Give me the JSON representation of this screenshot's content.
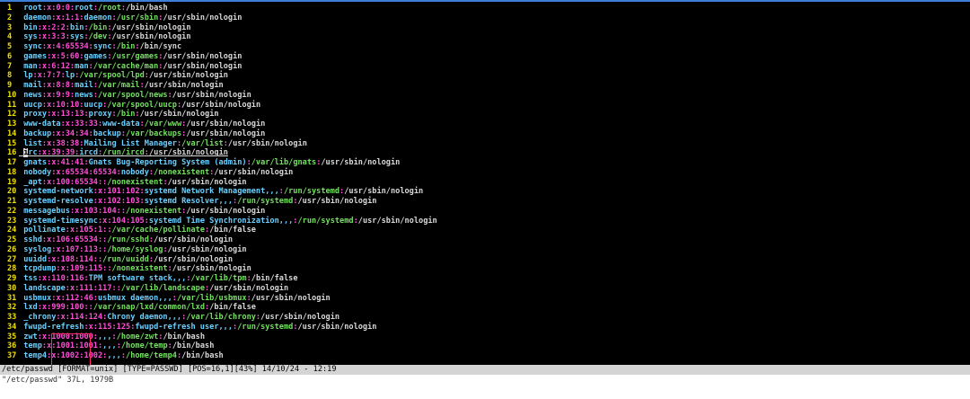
{
  "editor": {
    "lines": [
      {
        "n": "1",
        "user": "root",
        "x": ":x:0:0:",
        "gecos": "root",
        "home": "/root",
        "shell": "/bin/bash"
      },
      {
        "n": "2",
        "user": "daemon",
        "x": ":x:1:1:",
        "gecos": "daemon",
        "home": "/usr/sbin",
        "shell": "/usr/sbin/nologin"
      },
      {
        "n": "3",
        "user": "bin",
        "x": ":x:2:2:",
        "gecos": "bin",
        "home": "/bin",
        "shell": "/usr/sbin/nologin"
      },
      {
        "n": "4",
        "user": "sys",
        "x": ":x:3:3:",
        "gecos": "sys",
        "home": "/dev",
        "shell": "/usr/sbin/nologin"
      },
      {
        "n": "5",
        "user": "sync",
        "x": ":x:4:65534:",
        "gecos": "sync",
        "home": "/bin",
        "shell": "/bin/sync"
      },
      {
        "n": "6",
        "user": "games",
        "x": ":x:5:60:",
        "gecos": "games",
        "home": "/usr/games",
        "shell": "/usr/sbin/nologin"
      },
      {
        "n": "7",
        "user": "man",
        "x": ":x:6:12:",
        "gecos": "man",
        "home": "/var/cache/man",
        "shell": "/usr/sbin/nologin"
      },
      {
        "n": "8",
        "user": "lp",
        "x": ":x:7:7:",
        "gecos": "lp",
        "home": "/var/spool/lpd",
        "shell": "/usr/sbin/nologin"
      },
      {
        "n": "9",
        "user": "mail",
        "x": ":x:8:8:",
        "gecos": "mail",
        "home": "/var/mail",
        "shell": "/usr/sbin/nologin"
      },
      {
        "n": "10",
        "user": "news",
        "x": ":x:9:9:",
        "gecos": "news",
        "home": "/var/spool/news",
        "shell": "/usr/sbin/nologin"
      },
      {
        "n": "11",
        "user": "uucp",
        "x": ":x:10:10:",
        "gecos": "uucp",
        "home": "/var/spool/uucp",
        "shell": "/usr/sbin/nologin"
      },
      {
        "n": "12",
        "user": "proxy",
        "x": ":x:13:13:",
        "gecos": "proxy",
        "home": "/bin",
        "shell": "/usr/sbin/nologin"
      },
      {
        "n": "13",
        "user": "www-data",
        "x": ":x:33:33:",
        "gecos": "www-data",
        "home": "/var/www",
        "shell": "/usr/sbin/nologin"
      },
      {
        "n": "14",
        "user": "backup",
        "x": ":x:34:34:",
        "gecos": "backup",
        "home": "/var/backups",
        "shell": "/usr/sbin/nologin"
      },
      {
        "n": "15",
        "user": "list",
        "x": ":x:38:38:",
        "gecos": "Mailing List Manager",
        "home": "/var/list",
        "shell": "/usr/sbin/nologin"
      },
      {
        "n": "16",
        "user": "irc",
        "x": ":x:39:39:",
        "gecos": "ircd",
        "home": "/run/ircd",
        "shell": "/usr/sbin/nologin"
      },
      {
        "n": "17",
        "user": "gnats",
        "x": ":x:41:41:",
        "gecos": "Gnats Bug-Reporting System (admin)",
        "home": "/var/lib/gnats",
        "shell": "/usr/sbin/nologin"
      },
      {
        "n": "18",
        "user": "nobody",
        "x": ":x:65534:65534:",
        "gecos": "nobody",
        "home": "/nonexistent",
        "shell": "/usr/sbin/nologin"
      },
      {
        "n": "19",
        "user": "_apt",
        "x": ":x:100:65534:",
        "gecos": "",
        "home": "/nonexistent",
        "shell": "/usr/sbin/nologin"
      },
      {
        "n": "20",
        "user": "systemd-network",
        "x": ":x:101:102:",
        "gecos": "systemd Network Management,,,",
        "home": "/run/systemd",
        "shell": "/usr/sbin/nologin"
      },
      {
        "n": "21",
        "user": "systemd-resolve",
        "x": ":x:102:103:",
        "gecos": "systemd Resolver,,,",
        "home": "/run/systemd",
        "shell": "/usr/sbin/nologin"
      },
      {
        "n": "22",
        "user": "messagebus",
        "x": ":x:103:104:",
        "gecos": "",
        "home": "/nonexistent",
        "shell": "/usr/sbin/nologin"
      },
      {
        "n": "23",
        "user": "systemd-timesync",
        "x": ":x:104:105:",
        "gecos": "systemd Time Synchronization,,,",
        "home": "/run/systemd",
        "shell": "/usr/sbin/nologin"
      },
      {
        "n": "24",
        "user": "pollinate",
        "x": ":x:105:1:",
        "gecos": "",
        "home": "/var/cache/pollinate",
        "shell": "/bin/false"
      },
      {
        "n": "25",
        "user": "sshd",
        "x": ":x:106:65534:",
        "gecos": "",
        "home": "/run/sshd",
        "shell": "/usr/sbin/nologin"
      },
      {
        "n": "26",
        "user": "syslog",
        "x": ":x:107:113:",
        "gecos": "",
        "home": "/home/syslog",
        "shell": "/usr/sbin/nologin"
      },
      {
        "n": "27",
        "user": "uuidd",
        "x": ":x:108:114:",
        "gecos": "",
        "home": "/run/uuidd",
        "shell": "/usr/sbin/nologin"
      },
      {
        "n": "28",
        "user": "tcpdump",
        "x": ":x:109:115:",
        "gecos": "",
        "home": "/nonexistent",
        "shell": "/usr/sbin/nologin"
      },
      {
        "n": "29",
        "user": "tss",
        "x": ":x:110:116:",
        "gecos": "TPM software stack,,,",
        "home": "/var/lib/tpm",
        "shell": "/bin/false"
      },
      {
        "n": "30",
        "user": "landscape",
        "x": ":x:111:117:",
        "gecos": "",
        "home": "/var/lib/landscape",
        "shell": "/usr/sbin/nologin"
      },
      {
        "n": "31",
        "user": "usbmux",
        "x": ":x:112:46:",
        "gecos": "usbmux daemon,,,",
        "home": "/var/lib/usbmux",
        "shell": "/usr/sbin/nologin"
      },
      {
        "n": "32",
        "user": "lxd",
        "x": ":x:999:100:",
        "gecos": "",
        "home": "/var/snap/lxd/common/lxd",
        "shell": "/bin/false"
      },
      {
        "n": "33",
        "user": "_chrony",
        "x": ":x:114:124:",
        "gecos": "Chrony daemon,,,",
        "home": "/var/lib/chrony",
        "shell": "/usr/sbin/nologin"
      },
      {
        "n": "34",
        "user": "fwupd-refresh",
        "x": ":x:115:125:",
        "gecos": "fwupd-refresh user,,,",
        "home": "/run/systemd",
        "shell": "/usr/sbin/nologin"
      },
      {
        "n": "35",
        "user": "zwt",
        "x": ":x:1000:1000:",
        "gecos": ",,,",
        "home": "/home/zwt",
        "shell": "/bin/bash"
      },
      {
        "n": "36",
        "user": "temp",
        "x": ":x:1001:1001:",
        "gecos": ",,,",
        "home": "/home/temp",
        "shell": "/bin/bash"
      },
      {
        "n": "37",
        "user": "temp4",
        "x": ":x:1002:1002:",
        "gecos": ",,,",
        "home": "/home/temp4",
        "shell": "/bin/bash"
      }
    ],
    "cursor_line": "16"
  },
  "status_bar": "/etc/passwd [FORMAT=unix] [TYPE=PASSWD] [POS=16,1][43%] 14/10/24 - 12:19",
  "command_line": "\"/etc/passwd\" 37L, 1979B",
  "colors": {
    "background": "#000000",
    "line_numbers": "#f0e000",
    "username": "#6ad0ff",
    "separator_fields": "#ff4fd8",
    "home_dir": "#74e060",
    "annotation_box": "#ff2c6a"
  }
}
